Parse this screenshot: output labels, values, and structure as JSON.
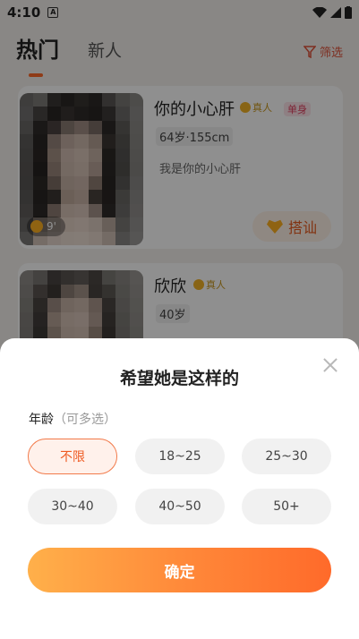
{
  "status_bar": {
    "time": "4:10",
    "notif_letter": "A"
  },
  "tabs": {
    "active": "热门",
    "other": "新人"
  },
  "filter": {
    "label": "筛选"
  },
  "cards": [
    {
      "name": "你的小心肝",
      "real_badge": "真人",
      "single_badge": "单身",
      "meta": "64岁·155cm",
      "bio": "我是你的小心肝",
      "views": "9'",
      "flirt": "搭讪"
    },
    {
      "name": "欣欣",
      "real_badge": "真人",
      "meta": "40岁"
    }
  ],
  "sheet": {
    "title": "希望她是这样的",
    "section_label": "年龄",
    "section_hint": "（可多选）",
    "options": [
      "不限",
      "18~25",
      "25~30",
      "30~40",
      "40~50",
      "50+"
    ],
    "selected": "不限",
    "confirm": "确定"
  },
  "colors": {
    "accent": "#ff6a2a",
    "gradient_start": "#ffb04a",
    "gradient_end": "#ff6a2a"
  }
}
